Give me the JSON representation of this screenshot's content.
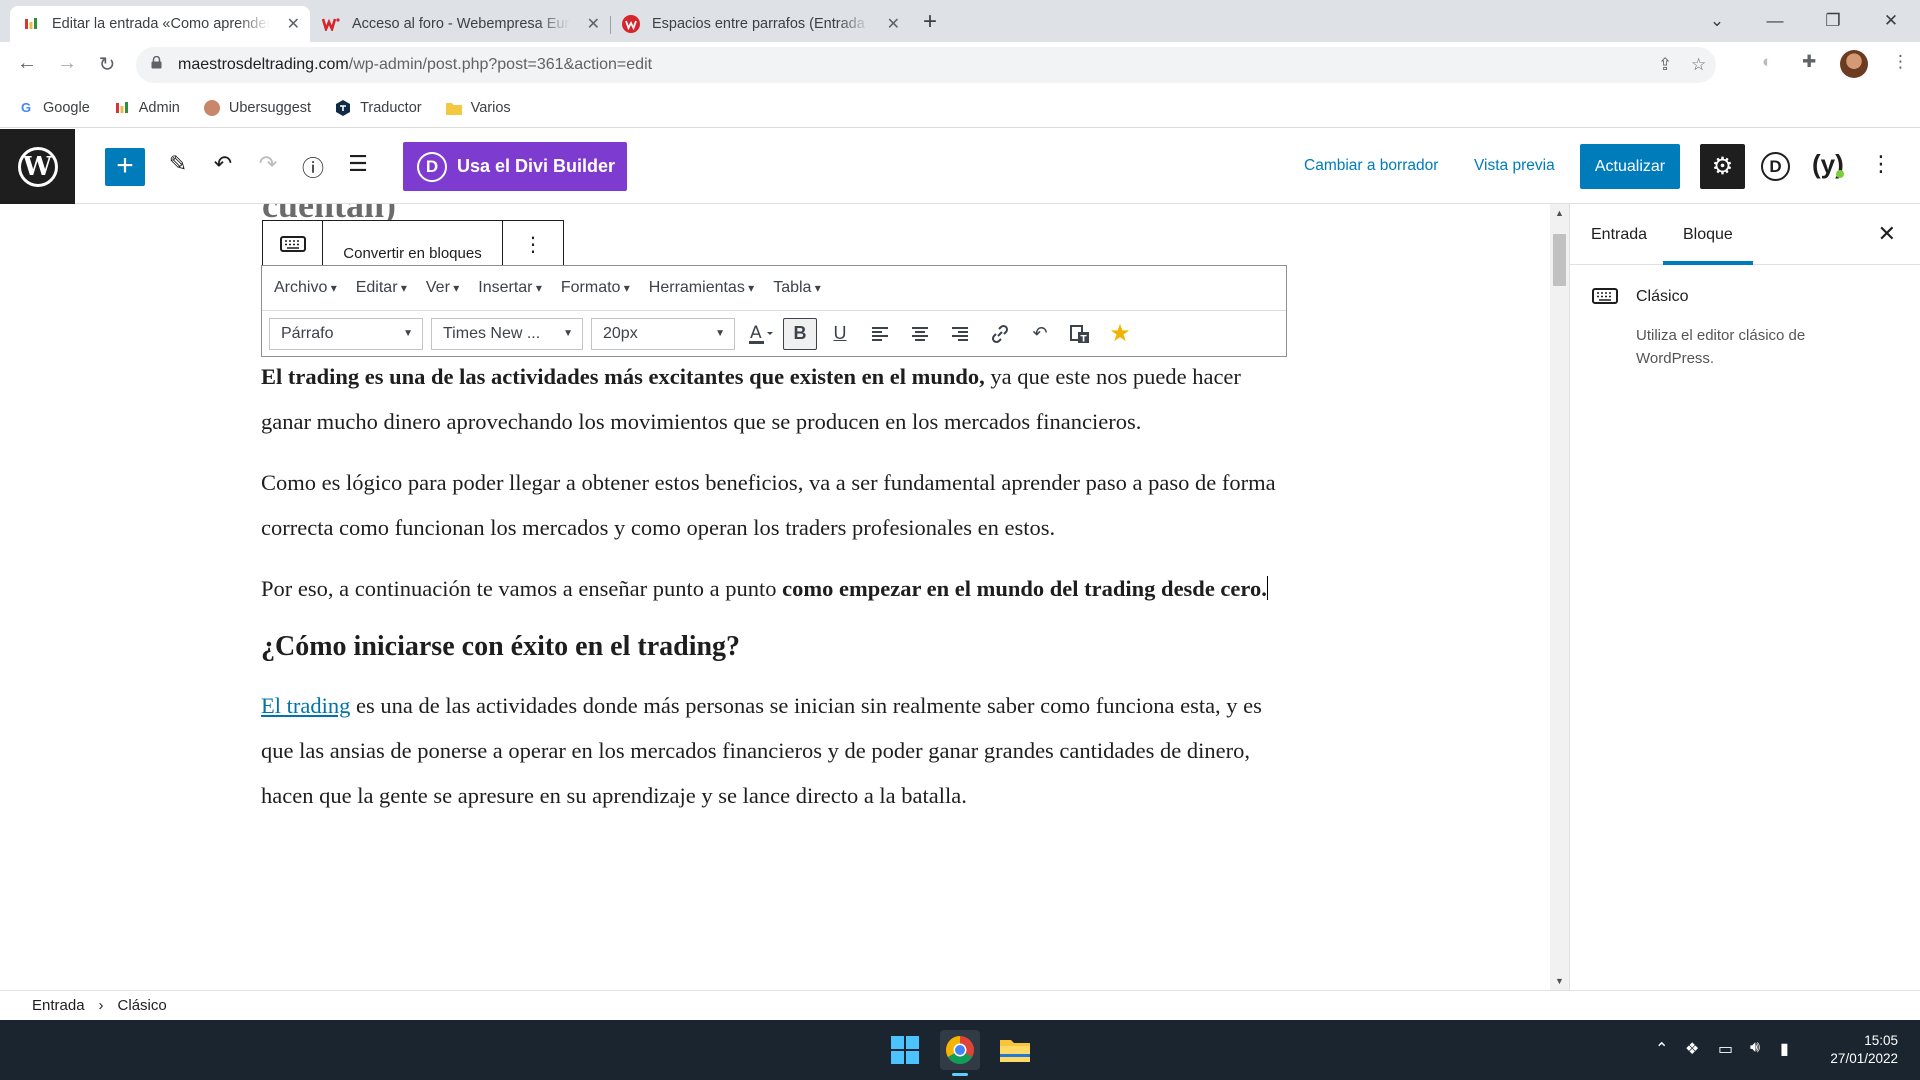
{
  "browser": {
    "tabs": [
      {
        "title": "Editar la entrada «Como aprender",
        "favicon": "admin-bars-icon",
        "active": true
      },
      {
        "title": "Acceso al foro - Webempresa Eur",
        "favicon": "webempresa-icon",
        "active": false
      },
      {
        "title": "Espacios entre parrafos (Entrada",
        "favicon": "webempresa-circle-icon",
        "active": false
      }
    ],
    "new_tab": "+",
    "url_host": "maestrosdeltrading.com",
    "url_path": "/wp-admin/post.php?post=361&action=edit",
    "bookmarks": [
      {
        "label": "Google",
        "icon": "google-icon"
      },
      {
        "label": "Admin",
        "icon": "admin-bars-icon"
      },
      {
        "label": "Ubersuggest",
        "icon": "ubersuggest-icon"
      },
      {
        "label": "Traductor",
        "icon": "translator-icon"
      },
      {
        "label": "Varios",
        "icon": "folder-icon"
      }
    ]
  },
  "wp_header": {
    "divi_button": "Usa el Divi Builder",
    "divi_letter": "D",
    "switch_draft": "Cambiar a borrador",
    "preview": "Vista previa",
    "update": "Actualizar"
  },
  "editor": {
    "previous_heading": "cuentan)",
    "block_toolbar": {
      "convert": "Convertir en bloques"
    },
    "menu": [
      "Archivo",
      "Editar",
      "Ver",
      "Insertar",
      "Formato",
      "Herramientas",
      "Tabla"
    ],
    "format_select": "Párrafo",
    "font_select": "Times New ...",
    "size_select": "20px",
    "paragraphs": {
      "p1_bold": "El trading es una de las actividades más excitantes que existen en el mundo,",
      "p1_rest": " ya que este nos puede hacer ganar mucho dinero aprovechando los movimientos que se producen en los mercados financieros.",
      "p2": "Como es lógico para poder llegar a obtener estos beneficios, va a ser fundamental aprender paso a paso de forma correcta como funcionan los mercados y como operan los traders profesionales en estos.",
      "p3_start": "Por eso, a continuación te vamos a enseñar punto a punto ",
      "p3_bold": "como empezar en el mundo del trading desde cero.",
      "h2": "¿Cómo iniciarse con éxito en el trading?",
      "p4_link": "El trading",
      "p4_rest": " es una de las actividades donde más personas se inician sin realmente saber como funciona esta, y es que las ansias de ponerse a operar en los mercados financieros y de poder ganar grandes cantidades de dinero, hacen que la gente se apresure en su aprendizaje y se lance directo a la batalla."
    }
  },
  "sidebar": {
    "tab_post": "Entrada",
    "tab_block": "Bloque",
    "block_name": "Clásico",
    "block_desc": "Utiliza el editor clásico de WordPress."
  },
  "breadcrumb": {
    "root": "Entrada",
    "sep": "›",
    "current": "Clásico"
  },
  "taskbar": {
    "time": "15:05",
    "date": "27/01/2022"
  },
  "colors": {
    "wp_blue": "#007cba",
    "divi_purple": "#7e3bd0",
    "taskbar": "#1b2530"
  }
}
